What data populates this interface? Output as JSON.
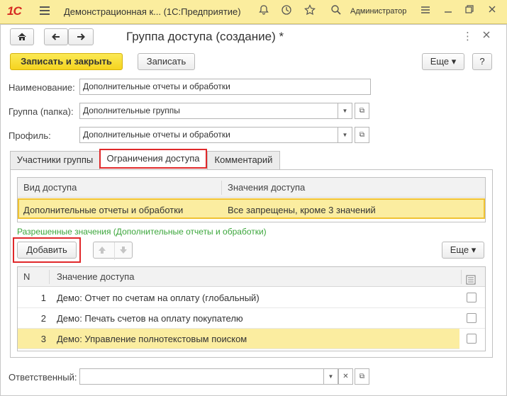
{
  "titlebar": {
    "logo": "1С",
    "app_title": "Демонстрационная к... (1С:Предприятие)",
    "user": "Администратор",
    "icons": [
      "menu-icon",
      "bell-icon",
      "history-icon",
      "star-icon",
      "search-icon",
      "user-icon",
      "more-icon",
      "minimize-icon",
      "restore-icon",
      "close-icon"
    ]
  },
  "form": {
    "title": "Группа доступа (создание) *",
    "nav": {
      "home_icon": "⌂",
      "back_icon": "←",
      "forward_icon": "→"
    },
    "toolbar": {
      "save_close_label": "Записать и закрыть",
      "save_label": "Записать",
      "more_label": "Еще ▾",
      "help_label": "?"
    },
    "fields": {
      "name_label": "Наименование:",
      "name_value": "Дополнительные отчеты и обработки",
      "group_label": "Группа (папка):",
      "group_value": "Дополнительные группы",
      "profile_label": "Профиль:",
      "profile_value": "Дополнительные отчеты и обработки",
      "responsible_label": "Ответственный:",
      "responsible_value": ""
    },
    "tabs": [
      {
        "label": "Участники группы"
      },
      {
        "label": "Ограничения доступа"
      },
      {
        "label": "Комментарий"
      }
    ],
    "access_table": {
      "headers": [
        "Вид доступа",
        "Значения доступа"
      ],
      "rows": [
        {
          "kind": "Дополнительные отчеты и обработки",
          "values": "Все запрещены, кроме 3 значений"
        }
      ]
    },
    "allowed_title": "Разрешенные значения (Дополнительные отчеты и обработки)",
    "allowed_toolbar": {
      "add_label": "Добавить",
      "more_label": "Еще ▾"
    },
    "values_table": {
      "headers": {
        "n": "N",
        "value": "Значение доступа"
      },
      "rows": [
        {
          "n": "1",
          "value": "Демо: Отчет по счетам на оплату (глобальный)"
        },
        {
          "n": "2",
          "value": "Демо: Печать счетов на оплату покупателю"
        },
        {
          "n": "3",
          "value": "Демо: Управление полнотекстовым поиском"
        }
      ]
    }
  },
  "colors": {
    "accent": "#fbed9e",
    "highlight_row": "#fbeda0",
    "primary_button": "#f5d41f",
    "callout": "#e0282a",
    "green_title": "#3ba63b"
  }
}
